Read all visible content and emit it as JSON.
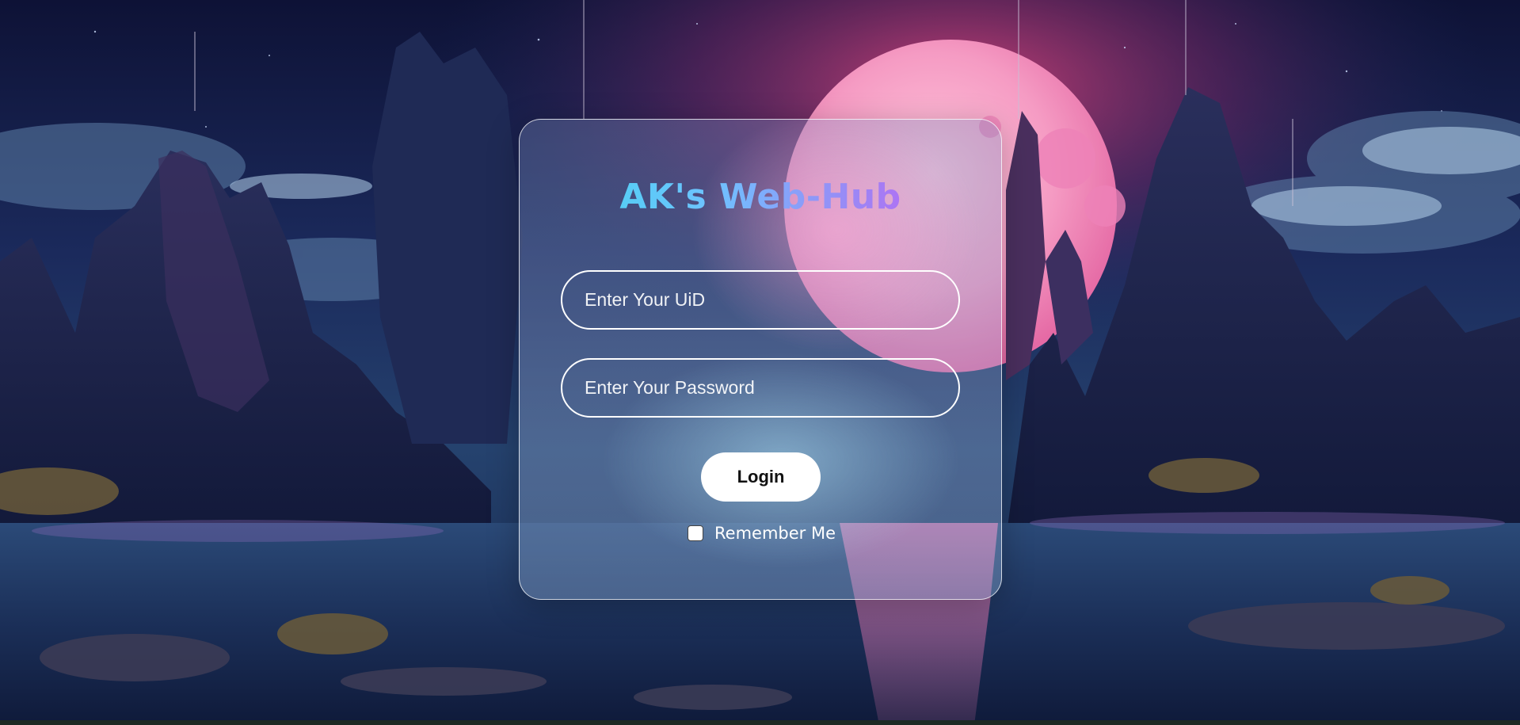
{
  "login": {
    "title": "AK's Web-Hub",
    "uid_placeholder": "Enter Your UiD",
    "password_placeholder": "Enter Your Password",
    "login_label": "Login",
    "remember_label": "Remember Me",
    "remember_checked": false
  },
  "colors": {
    "title_gradient": [
      "#3fd6ea",
      "#6ec3ff",
      "#9c86f5",
      "#d24df0"
    ],
    "field_border": "#ffffff",
    "button_bg": "#ffffff",
    "button_text": "#111111"
  }
}
